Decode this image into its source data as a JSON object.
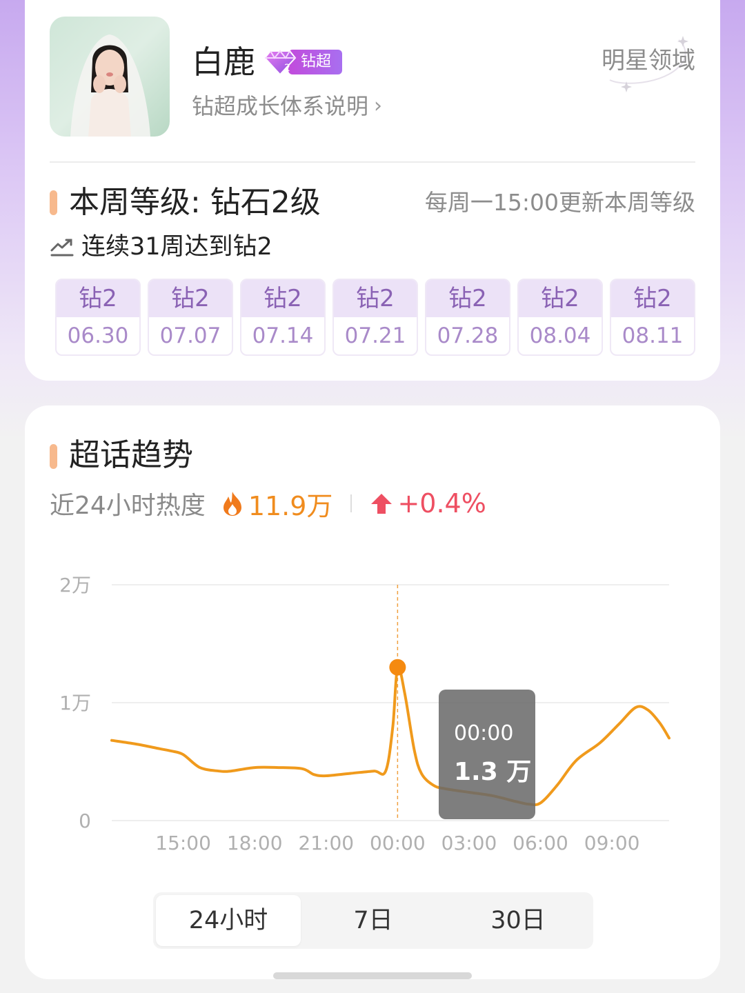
{
  "profile": {
    "name": "白鹿",
    "badge_level": "2",
    "badge_label": "钻超",
    "growth_link": "钻超成长体系说明",
    "domain_label": "明星领域"
  },
  "level": {
    "title": "本周等级: 钻石2级",
    "update_note": "每周一15:00更新本周等级",
    "streak": "连续31周达到钻2",
    "weeks": [
      {
        "level": "钻2",
        "date": "06.30"
      },
      {
        "level": "钻2",
        "date": "07.07"
      },
      {
        "level": "钻2",
        "date": "07.14"
      },
      {
        "level": "钻2",
        "date": "07.21"
      },
      {
        "level": "钻2",
        "date": "07.28"
      },
      {
        "level": "钻2",
        "date": "08.04"
      },
      {
        "level": "钻2",
        "date": "08.11"
      }
    ]
  },
  "trend": {
    "title": "超话趋势",
    "heat_label": "近24小时热度",
    "heat_value": "11.9万",
    "heat_change": "+0.4%",
    "tooltip_time": "00:00",
    "tooltip_value": "1.3 万",
    "tabs": [
      "24小时",
      "7日",
      "30日"
    ],
    "active_tab": "24小时"
  },
  "colors": {
    "accent": "#f7b98d",
    "line": "#f09a1c",
    "heat": "#f08c1e",
    "up": "#ee4f62",
    "badge": "#b25fe6"
  },
  "chart_data": {
    "type": "line",
    "yticks": [
      "2万",
      "1万",
      "0"
    ],
    "xticks": [
      "15:00",
      "18:00",
      "21:00",
      "00:00",
      "03:00",
      "06:00",
      "09:00"
    ],
    "ylim": [
      0,
      2.0
    ],
    "y_unit": "万",
    "xlim_hours": [
      12.0,
      35.4
    ],
    "grid": true,
    "highlight": {
      "x": 24,
      "y": 1.3,
      "label": "00:00"
    },
    "x": [
      12.0,
      13.0,
      14.0,
      14.5,
      15.0,
      15.7,
      16.5,
      17.0,
      18.0,
      19.0,
      20.0,
      20.5,
      21.0,
      22.0,
      23.0,
      23.5,
      23.8,
      24.0,
      24.3,
      24.7,
      25.0,
      25.5,
      26.0,
      27.0,
      28.0,
      29.0,
      29.5,
      30.0,
      30.7,
      31.5,
      32.5,
      33.3,
      34.0,
      34.5,
      35.0,
      35.4
    ],
    "y": [
      0.68,
      0.65,
      0.61,
      0.59,
      0.56,
      0.45,
      0.42,
      0.42,
      0.45,
      0.45,
      0.44,
      0.39,
      0.38,
      0.4,
      0.42,
      0.42,
      0.8,
      1.3,
      1.08,
      0.6,
      0.4,
      0.3,
      0.27,
      0.24,
      0.21,
      0.16,
      0.14,
      0.15,
      0.3,
      0.51,
      0.66,
      0.82,
      0.96,
      0.94,
      0.83,
      0.7
    ]
  }
}
